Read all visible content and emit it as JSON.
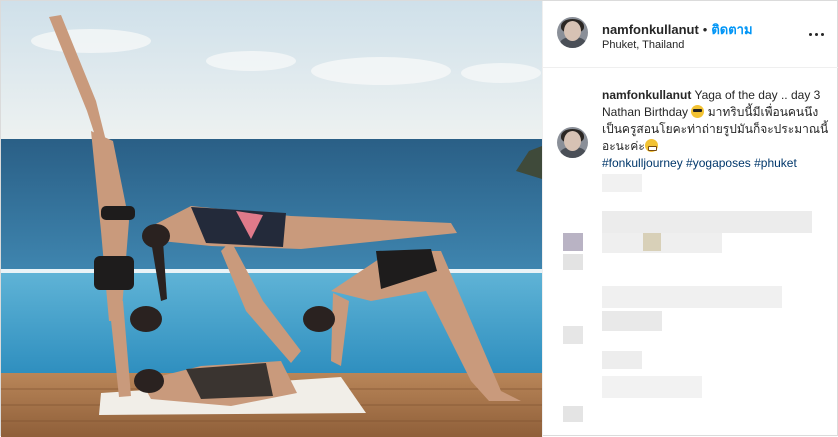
{
  "post": {
    "username": "namfonkullanut",
    "separator": "•",
    "follow_label": "ติดตาม",
    "location": "Phuket, Thailand",
    "more_icon": "ellipsis-icon"
  },
  "caption": {
    "username": "namfonkullanut",
    "text_part1": "Yaga of the day .. day 3 Nathan Birthday",
    "emoji1": "sunglasses-emoji",
    "text_part2": "มาทริบนี้มีเพื่อนคนนึงเป็นครูสอนโยคะท่าถ่ายรูปมันก็จะประมาณนี้อะนะค่ะ",
    "emoji2": "grimace-emoji",
    "hashtags": "#fonkulljourney #yogaposes #phuket"
  },
  "colors": {
    "follow": "#0095f6",
    "hashtag": "#00376b",
    "sky": "#dfe9ee",
    "sea": "#2f6f9a",
    "deck": "#b07a4e"
  }
}
